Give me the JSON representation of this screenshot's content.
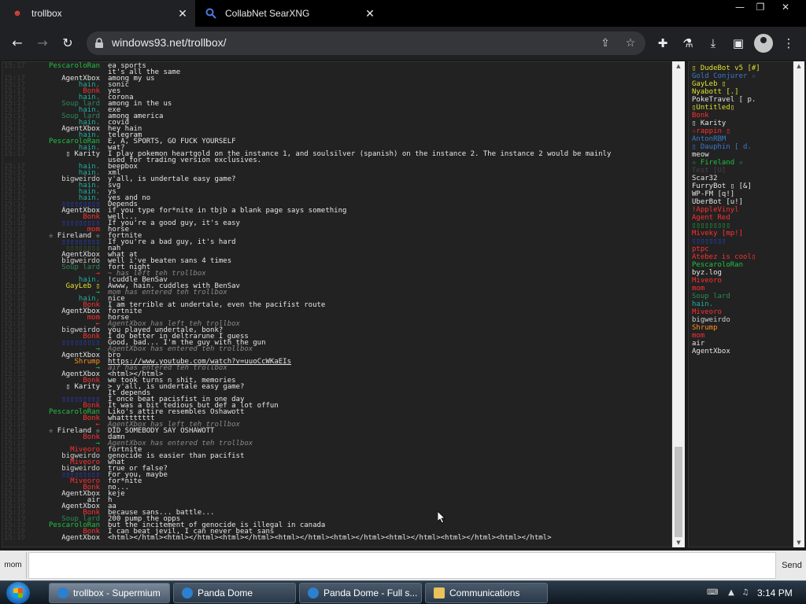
{
  "browser": {
    "tabs": [
      {
        "title": "trollbox",
        "active": true
      },
      {
        "title": "CollabNet SearXNG",
        "active": false
      }
    ],
    "url": "windows93.net/trollbox/"
  },
  "chat": {
    "messages": [
      {
        "time": "15:17",
        "nick": "PescaroloRan",
        "color": "#20c040",
        "text": "ea sports"
      },
      {
        "time": "",
        "nick": "",
        "color": "#fff",
        "text": "it's all the same"
      },
      {
        "time": "15:17",
        "nick": "AgentXbox",
        "color": "#e6e6e6",
        "text": "among my us"
      },
      {
        "time": "15:17",
        "nick": "hain.",
        "color": "#20b0a0",
        "text": "sonic"
      },
      {
        "time": "15:17",
        "nick": "Bonk",
        "color": "#ff3030",
        "text": "yes"
      },
      {
        "time": "15:17",
        "nick": "hain.",
        "color": "#20b0a0",
        "text": "corona"
      },
      {
        "time": "15:17",
        "nick": "Soup lard",
        "color": "#2a8a5a",
        "text": "among in the us"
      },
      {
        "time": "15:17",
        "nick": "hain.",
        "color": "#20b0a0",
        "text": "exe"
      },
      {
        "time": "15:17",
        "nick": "Soup lard",
        "color": "#2a8a5a",
        "text": "among america"
      },
      {
        "time": "15:17",
        "nick": "hain.",
        "color": "#20b0a0",
        "text": "covid"
      },
      {
        "time": "15:17",
        "nick": "AgentXbox",
        "color": "#e6e6e6",
        "text": "hey hain"
      },
      {
        "time": "15:17",
        "nick": "hain.",
        "color": "#20b0a0",
        "text": "telegram"
      },
      {
        "time": "15:17",
        "nick": "PescaroloRan",
        "color": "#20c040",
        "text": "E, A, SPORTS, GO FUCK YOURSELF"
      },
      {
        "time": "15:17",
        "nick": "hain.",
        "color": "#20b0a0",
        "text": "wat?"
      },
      {
        "time": "15:17",
        "nick": "▯ Karity",
        "color": "#e6e6e6",
        "text": "I play pokemon heartgold on the instance 1, and soulsilver (spanish) on the instance 2. The instance 2 would be mainly"
      },
      {
        "time": "",
        "nick": "",
        "color": "#fff",
        "text": "used for trading version exclusives."
      },
      {
        "time": "15:17",
        "nick": "hain.",
        "color": "#20b0a0",
        "text": "beepbox"
      },
      {
        "time": "15:17",
        "nick": "hain.",
        "color": "#20b0a0",
        "text": "xml"
      },
      {
        "time": "15:17",
        "nick": "bigweirdo",
        "color": "#cfcfcf",
        "text": "y'all, is undertale easy game?"
      },
      {
        "time": "15:17",
        "nick": "hain.",
        "color": "#20b0a0",
        "text": "svg"
      },
      {
        "time": "15:17",
        "nick": "hain.",
        "color": "#20b0a0",
        "text": "ys"
      },
      {
        "time": "15:17",
        "nick": "hain.",
        "color": "#20b0a0",
        "text": "yes and no"
      },
      {
        "time": "15:17",
        "nick": "▯▯▯▯▯▯▯▯▯",
        "color": "#2a40c8",
        "text": "Depends"
      },
      {
        "time": "15:17",
        "nick": "AgentXbox",
        "color": "#e6e6e6",
        "text": "if you type for*nite in tbjb a blank page says something"
      },
      {
        "time": "15:18",
        "nick": "Bonk",
        "color": "#ff3030",
        "text": "well..."
      },
      {
        "time": "15:18",
        "nick": "▯▯▯▯▯▯▯▯▯",
        "color": "#2a40c8",
        "text": "If you're a good guy, it's easy"
      },
      {
        "time": "15:18",
        "nick": "mom",
        "color": "#ff3030",
        "text": "horse"
      },
      {
        "time": "15:18",
        "nick": "☆ Fireland ☆",
        "color": "#e6e6e6",
        "text": "fortnite"
      },
      {
        "time": "15:18",
        "nick": "▯▯▯▯▯▯▯▯▯",
        "color": "#2a40c8",
        "text": "If you're a bad guy, it's hard"
      },
      {
        "time": "15:18",
        "nick": "▯▯▯▯▯▯▯▯",
        "color": "#3a5a3a",
        "text": "nah"
      },
      {
        "time": "15:18",
        "nick": "AgentXbox",
        "color": "#e6e6e6",
        "text": "what at"
      },
      {
        "time": "15:18",
        "nick": "bigweirdo",
        "color": "#cfcfcf",
        "text": "well i've beaten sans 4 times"
      },
      {
        "time": "15:18",
        "nick": "Soup lard",
        "color": "#2a8a5a",
        "text": "fort night"
      },
      {
        "time": "15:18",
        "nick": "→",
        "color": "#ff3030",
        "text": "~ has left teh trollbox",
        "system": true
      },
      {
        "time": "15:18",
        "nick": "hain.",
        "color": "#20b0a0",
        "text": "!cuddle BenSav"
      },
      {
        "time": "15:18",
        "nick": "GayLeb ▯",
        "color": "#e0e030",
        "text": "Awww, hain. cuddles with BenSav"
      },
      {
        "time": "15:18",
        "nick": "→",
        "color": "#20c040",
        "text": "mom has entered teh trollbox",
        "system": true
      },
      {
        "time": "15:18",
        "nick": "hain.",
        "color": "#20b0a0",
        "text": "nice"
      },
      {
        "time": "15:18",
        "nick": "Bonk",
        "color": "#ff3030",
        "text": "I am terrible at undertale, even the pacifist route"
      },
      {
        "time": "15:18",
        "nick": "AgentXbox",
        "color": "#e6e6e6",
        "text": "fortnite"
      },
      {
        "time": "15:18",
        "nick": "mom",
        "color": "#ff3030",
        "text": "horse"
      },
      {
        "time": "15:18",
        "nick": "←",
        "color": "#ff3030",
        "text": "AgentXbox has left teh trollbox",
        "system": true
      },
      {
        "time": "15:18",
        "nick": "bigweirdo",
        "color": "#cfcfcf",
        "text": "you played undertale, bonk?"
      },
      {
        "time": "15:18",
        "nick": "Bonk",
        "color": "#ff3030",
        "text": "I do better in deltrarune I guess"
      },
      {
        "time": "15:18",
        "nick": "▯▯▯▯▯▯▯▯▯",
        "color": "#2a40c8",
        "text": "Good, bad... I'm the guy with the gun"
      },
      {
        "time": "15:18",
        "nick": "→",
        "color": "#20c040",
        "text": "AgentXbox has entered teh trollbox",
        "system": true
      },
      {
        "time": "15:18",
        "nick": "AgentXbox",
        "color": "#e6e6e6",
        "text": "bro"
      },
      {
        "time": "15:18",
        "nick": "Shrump",
        "color": "#ff9020",
        "text": "https://www.youtube.com/watch?v=uuoCcWKaEIs",
        "link": true
      },
      {
        "time": "15:18",
        "nick": "→",
        "color": "#20c040",
        "text": "air has entered teh trollbox",
        "system": true
      },
      {
        "time": "15:18",
        "nick": "AgentXbox",
        "color": "#e6e6e6",
        "text": "<html></html>"
      },
      {
        "time": "15:18",
        "nick": "Bonk",
        "color": "#ff3030",
        "text": "we took turns n shit, memories"
      },
      {
        "time": "15:18",
        "nick": "▯ Karity",
        "color": "#e6e6e6",
        "text": "> y'all, is undertale easy game?"
      },
      {
        "time": "15:18",
        "nick": "",
        "color": "#fff",
        "text": "It depends"
      },
      {
        "time": "15:18",
        "nick": "▯▯▯▯▯▯▯▯▯",
        "color": "#2a40c8",
        "text": "I once beat pacisfist in one day"
      },
      {
        "time": "15:18",
        "nick": "Bonk",
        "color": "#ff3030",
        "text": "It was a bit tedious but def a lot offun"
      },
      {
        "time": "15:18",
        "nick": "PescaroloRan",
        "color": "#20c040",
        "text": "Liko's attire resembles Oshawott"
      },
      {
        "time": "15:18",
        "nick": "Bonk",
        "color": "#ff3030",
        "text": "whatttttttt"
      },
      {
        "time": "15:18",
        "nick": "←",
        "color": "#ff3030",
        "text": "AgentXbox has left teh trollbox",
        "system": true
      },
      {
        "time": "15:18",
        "nick": "☆ Fireland ☆",
        "color": "#e6e6e6",
        "text": "DID SOMEBODY SAY OSHAWOTT"
      },
      {
        "time": "15:18",
        "nick": "Bonk",
        "color": "#ff3030",
        "text": "damn"
      },
      {
        "time": "15:18",
        "nick": "→",
        "color": "#20c040",
        "text": "AgentXbox has entered teh trollbox",
        "system": true
      },
      {
        "time": "15:18",
        "nick": "Miveoro",
        "color": "#ff3030",
        "text": "fortnite"
      },
      {
        "time": "15:18",
        "nick": "bigweirdo",
        "color": "#cfcfcf",
        "text": "genocide is easier than pacifist"
      },
      {
        "time": "15:18",
        "nick": "Miveoro",
        "color": "#ff3030",
        "text": "what"
      },
      {
        "time": "15:18",
        "nick": "bigweirdo",
        "color": "#cfcfcf",
        "text": "true or false?"
      },
      {
        "time": "15:18",
        "nick": "▯▯▯▯▯▯▯▯▯",
        "color": "#2a40c8",
        "text": "For you, maybe"
      },
      {
        "time": "15:18",
        "nick": "Miveoro",
        "color": "#ff3030",
        "text": "for*nite"
      },
      {
        "time": "15:18",
        "nick": "Bonk",
        "color": "#ff3030",
        "text": "no..."
      },
      {
        "time": "15:18",
        "nick": "AgentXbox",
        "color": "#e6e6e6",
        "text": "keje"
      },
      {
        "time": "15:18",
        "nick": "air",
        "color": "#e6e6e6",
        "text": "h"
      },
      {
        "time": "15:19",
        "nick": "AgentXbox",
        "color": "#e6e6e6",
        "text": "aa"
      },
      {
        "time": "15:19",
        "nick": "Bonk",
        "color": "#ff3030",
        "text": "because sans... battle..."
      },
      {
        "time": "15:19",
        "nick": "Soup lard",
        "color": "#2a8a5a",
        "text": "200 pump the opps"
      },
      {
        "time": "15:19",
        "nick": "PescaroloRan",
        "color": "#20c040",
        "text": "but the incitement of genocide is illegal in canada"
      },
      {
        "time": "15:19",
        "nick": "Bonk",
        "color": "#ff3030",
        "text": "I can beat jevil, I can never beat sans"
      },
      {
        "time": "15:19",
        "nick": "AgentXbox",
        "color": "#e6e6e6",
        "text": "<html></html><html></html><html></html><html></html><html></html><html></html><html></html><html></html>"
      }
    ],
    "nick_button": "mom",
    "input_value": "",
    "send_label": "Send"
  },
  "users": [
    {
      "name": "▯ DudeBot v5 [#]",
      "color": "#e0e030"
    },
    {
      "name": "Gold Conjurer ☆",
      "color": "#3a7ad0"
    },
    {
      "name": "GayLeb ▯",
      "color": "#e0e030"
    },
    {
      "name": "Nyabott [.]",
      "color": "#e0e030"
    },
    {
      "name": "PokeTravel [ p.",
      "color": "#e6e6e6"
    },
    {
      "name": "▯Untitled▯",
      "color": "#e0e030"
    },
    {
      "name": "Bonk",
      "color": "#ff3030"
    },
    {
      "name": "▯ Karity",
      "color": "#e6e6e6"
    },
    {
      "name": "☆rappin ▯",
      "color": "#ff3030"
    },
    {
      "name": "AntonRBM",
      "color": "#3a7ad0"
    },
    {
      "name": "▯ Dauphin [ d.",
      "color": "#3a7ad0"
    },
    {
      "name": "meow",
      "color": "#e6e6e6"
    },
    {
      "name": "☆ Fireland ☆",
      "color": "#20c040"
    },
    {
      "name": "Test [U]",
      "color": "#444"
    },
    {
      "name": "Scar32",
      "color": "#e6e6e6"
    },
    {
      "name": "FurryBot ▯ [&]",
      "color": "#e6e6e6"
    },
    {
      "name": "WP-FM [q!]",
      "color": "#e6e6e6"
    },
    {
      "name": "UberBot [u!]",
      "color": "#e6e6e6"
    },
    {
      "name": "!AppleVinyl",
      "color": "#ff3030"
    },
    {
      "name": "Agent Red",
      "color": "#ff3030"
    },
    {
      "name": "▯▯▯▯▯▯▯▯▯",
      "color": "#20a040"
    },
    {
      "name": "Miveky [mp!]",
      "color": "#ff3030"
    },
    {
      "name": "▯▯▯▯▯▯▯▯",
      "color": "#2a40c8"
    },
    {
      "name": "ptpc",
      "color": "#ff3030"
    },
    {
      "name": "Atebez is cool▯",
      "color": "#ff3030"
    },
    {
      "name": "PescaroloRan",
      "color": "#20c040"
    },
    {
      "name": "byz.log",
      "color": "#e6e6e6"
    },
    {
      "name": "Miveoro",
      "color": "#ff3030"
    },
    {
      "name": "mom",
      "color": "#ff3030"
    },
    {
      "name": "Soup lard",
      "color": "#2a8a5a"
    },
    {
      "name": "hain.",
      "color": "#20b0a0"
    },
    {
      "name": "Miveoro",
      "color": "#ff3030"
    },
    {
      "name": "bigweirdo",
      "color": "#cfcfcf"
    },
    {
      "name": "Shrump",
      "color": "#ff9020"
    },
    {
      "name": "mom",
      "color": "#ff3030"
    },
    {
      "name": "air",
      "color": "#e6e6e6"
    },
    {
      "name": "AgentXbox",
      "color": "#e6e6e6"
    }
  ],
  "taskbar": {
    "items": [
      {
        "label": "trollbox - Supermium",
        "active": true,
        "icon": "globe-icon"
      },
      {
        "label": "Panda Dome",
        "active": false,
        "icon": "globe-icon"
      },
      {
        "label": "Panda Dome - Full s...",
        "active": false,
        "icon": "globe-icon"
      },
      {
        "label": "Communications",
        "active": false,
        "icon": "folder-icon"
      }
    ],
    "clock": "3:14 PM"
  }
}
